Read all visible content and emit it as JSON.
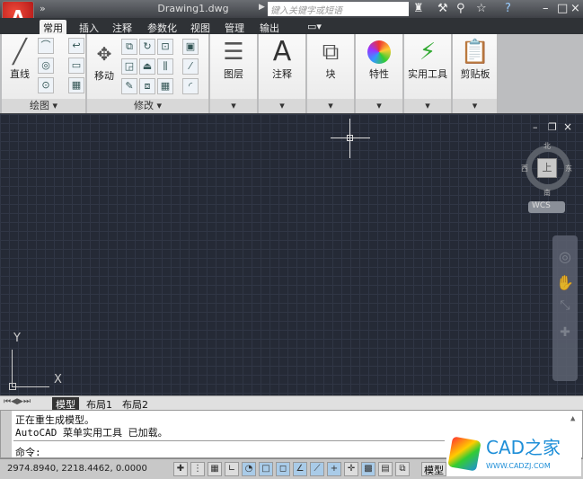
{
  "app": {
    "title": "Drawing1.dwg",
    "search_placeholder": "键入关键字或短语",
    "app_button": "A"
  },
  "title_icons": [
    "binoculars-icon",
    "wrench-icon",
    "satellite-icon",
    "star-icon",
    "help-icon"
  ],
  "tabs": [
    {
      "label": "常用",
      "active": true
    },
    {
      "label": "插入"
    },
    {
      "label": "注释"
    },
    {
      "label": "参数化"
    },
    {
      "label": "视图"
    },
    {
      "label": "管理"
    },
    {
      "label": "输出"
    }
  ],
  "panels": {
    "draw": {
      "title": "绘图",
      "big": "直线"
    },
    "modify": {
      "title": "修改",
      "big": "移动"
    },
    "layers": "图层",
    "annotation": "注释",
    "block": "块",
    "properties": "特性",
    "utilities": "实用工具",
    "clipboard": "剪贴板"
  },
  "viewcube": {
    "top": "上",
    "north": "北",
    "south": "南",
    "east": "东",
    "west": "西",
    "wcs": "WCS"
  },
  "ucs": {
    "x": "X",
    "y": "Y"
  },
  "layout_tabs": [
    "模型",
    "布局1",
    "布局2"
  ],
  "command": {
    "lines": [
      "正在重生成模型。",
      "AutoCAD 菜单实用工具 已加载。"
    ],
    "prompt": "命令:"
  },
  "status": {
    "coords": "2974.8940, 2218.4462, 0.0000",
    "model": "模型"
  },
  "watermark": {
    "brand": "CAD之家",
    "url": "WWW.CADZJ.COM"
  },
  "colors": {
    "canvas": "#252a36",
    "accent": "#1f8fd8"
  }
}
